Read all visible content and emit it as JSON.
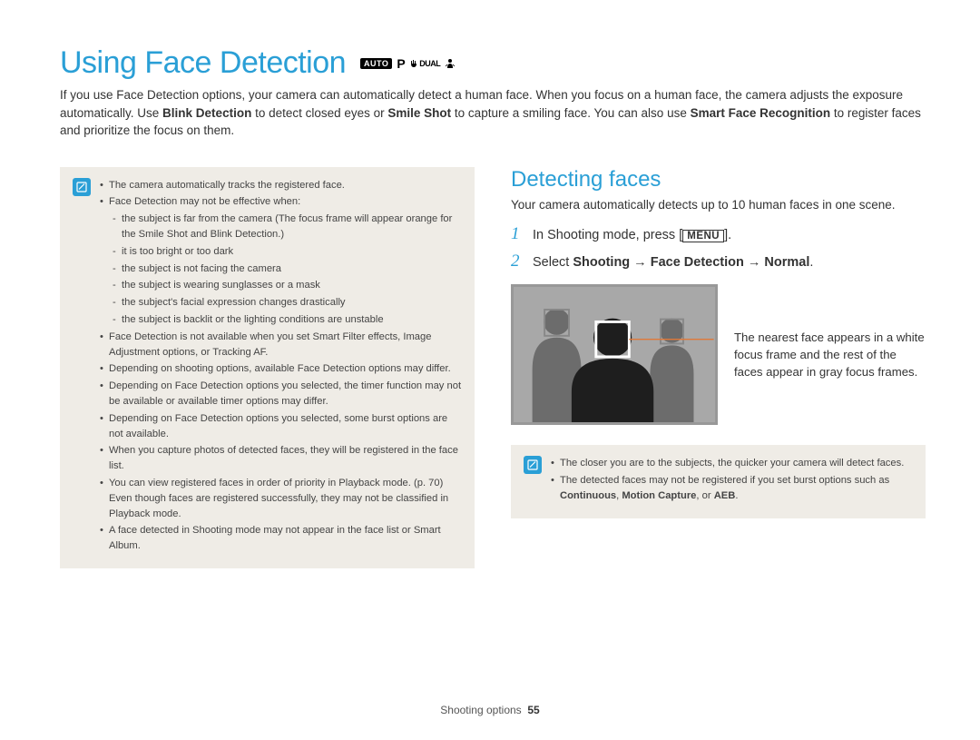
{
  "title": "Using Face Detection",
  "mode_icons": {
    "auto": "AUTO",
    "p": "P",
    "dual": "DUAL"
  },
  "intro_parts": {
    "p1a": "If you use Face Detection options, your camera can automatically detect a human face. When you focus on a human face, the camera adjusts the exposure automatically. Use ",
    "b1": "Blink Detection",
    "p1b": " to detect closed eyes or ",
    "b2": "Smile Shot",
    "p1c": " to capture a smiling face. You can also use ",
    "b3": "Smart Face Recognition",
    "p1d": " to register faces and prioritize the focus on them."
  },
  "notes_left": [
    {
      "text": "The camera automatically tracks the registered face."
    },
    {
      "text": "Face Detection may not be effective when:",
      "children": [
        "the subject is far from the camera (The focus frame will appear orange for the Smile Shot and Blink Detection.)",
        "it is too bright or too dark",
        "the subject is not facing the camera",
        "the subject is wearing sunglasses or a mask",
        "the subject's facial expression changes drastically",
        "the subject is backlit or the lighting conditions are unstable"
      ]
    },
    {
      "text": "Face Detection is not available when you set Smart Filter effects, Image Adjustment options, or Tracking AF."
    },
    {
      "text": "Depending on shooting options, available Face Detection options may differ."
    },
    {
      "text": "Depending on Face Detection options you selected, the timer function may not be available or available timer options may differ."
    },
    {
      "text": "Depending on Face Detection options you selected, some burst options are not available."
    },
    {
      "text": "When you capture photos of detected faces, they will be registered in the face list."
    },
    {
      "text": "You can view registered faces in order of priority in Playback mode. (p. 70) Even though faces are registered successfully, they may not be classified in Playback mode."
    },
    {
      "text": "A face detected in Shooting mode may not appear in the face list or Smart Album."
    }
  ],
  "right": {
    "heading": "Detecting faces",
    "desc": "Your camera automatically detects up to 10 human faces in one scene.",
    "steps": [
      {
        "pre": "In Shooting mode, press [",
        "key": "MENU",
        "post": "]."
      },
      {
        "pre": "Select ",
        "bold": "Shooting → Face Detection → Normal",
        "post": "."
      }
    ],
    "caption": "The nearest face appears in a white focus frame and the rest of the faces appear in gray focus frames."
  },
  "notes_right": [
    {
      "text": "The closer you are to the subjects, the quicker your camera will detect faces."
    },
    {
      "text_parts": {
        "a": "The detected faces may not be registered if you set burst options such as ",
        "b1": "Continuous",
        "s1": ", ",
        "b2": "Motion Capture",
        "s2": ", or ",
        "b3": "AEB",
        "s3": "."
      }
    }
  ],
  "footer": {
    "section": "Shooting options",
    "page": "55"
  }
}
